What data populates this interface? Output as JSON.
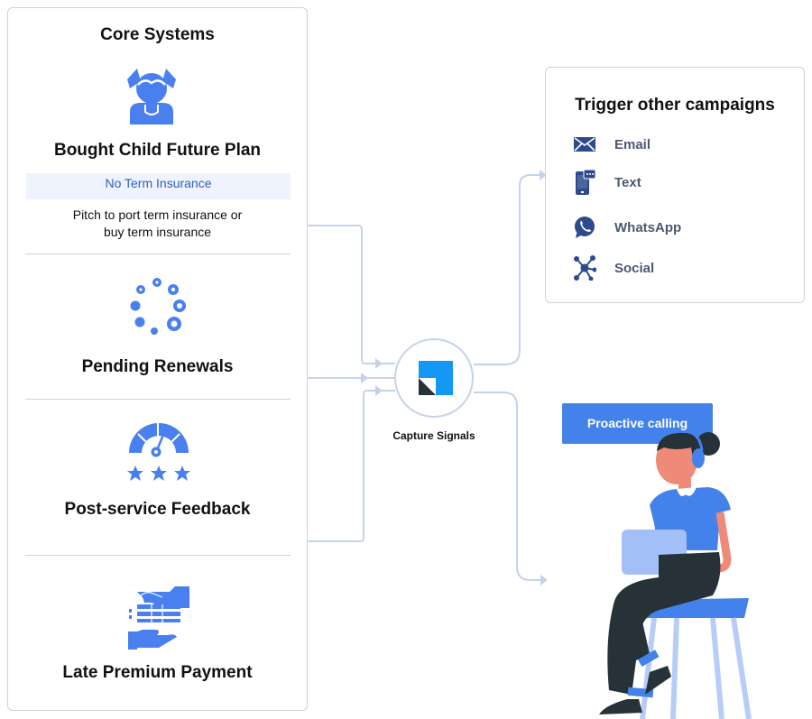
{
  "core_systems": {
    "title": "Core Systems",
    "sections": [
      {
        "icon": "child-girl-icon",
        "title": "Bought Child Future Plan",
        "highlight": "No Term Insurance",
        "description_line1": "Pitch to port term insurance or",
        "description_line2": "buy term insurance"
      },
      {
        "icon": "loading-dots-icon",
        "title": "Pending Renewals"
      },
      {
        "icon": "gauge-rating-icon",
        "title": "Post-service Feedback"
      },
      {
        "icon": "hand-payment-icon",
        "title": "Late Premium Payment"
      }
    ]
  },
  "hub": {
    "label": "Capture Signals",
    "icon": "logo-square-icon"
  },
  "trigger": {
    "title": "Trigger other campaigns",
    "channels": [
      {
        "label": "Email",
        "icon": "envelope-icon"
      },
      {
        "label": "Text",
        "icon": "mobile-chat-icon"
      },
      {
        "label": "WhatsApp",
        "icon": "whatsapp-icon"
      },
      {
        "label": "Social",
        "icon": "network-icon"
      }
    ]
  },
  "proactive": {
    "label": "Proactive calling",
    "illustration": "agent-with-headset-illustration"
  },
  "colors": {
    "accent": "#4382ea",
    "icon_blue": "#4a7ff0",
    "channel_icon": "#2c4a8c",
    "connector": "#c5d3ea",
    "hub_blue": "#1497f5",
    "dark": "#263238"
  }
}
